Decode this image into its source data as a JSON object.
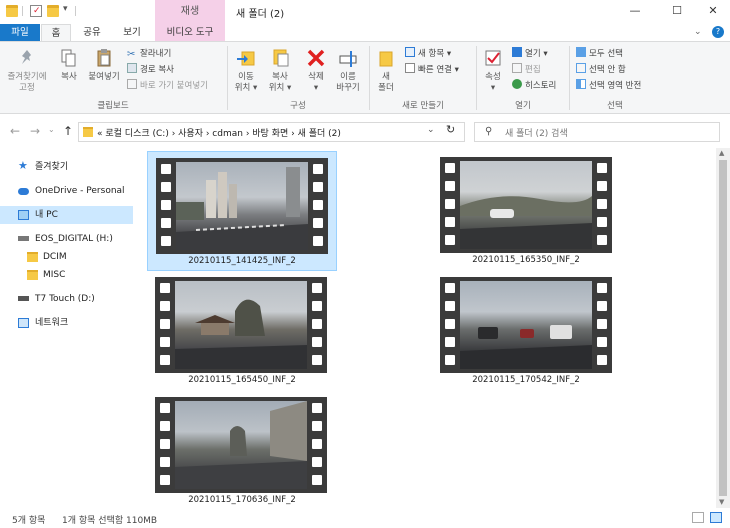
{
  "window": {
    "title": "새 폴더 (2)",
    "context_tab": "재생",
    "controls": [
      "—",
      "☐",
      "✕"
    ]
  },
  "ribbon_tabs": [
    {
      "label": "파일",
      "kind": "file"
    },
    {
      "label": "홈",
      "kind": "active"
    },
    {
      "label": "공유",
      "kind": "normal"
    },
    {
      "label": "보기",
      "kind": "normal"
    },
    {
      "label": "비디오 도구",
      "kind": "video"
    }
  ],
  "ribbon": {
    "clipboard": {
      "pin_label": "즐겨찾기에\n고정",
      "copy_label": "복사",
      "paste_label": "붙여넣기",
      "cut_label": "잘라내기",
      "copy_path_label": "경로 복사",
      "paste_shortcut_label": "바로 가기 붙여넣기",
      "group_label": "클립보드"
    },
    "organize": {
      "move_label": "이동\n위치 ▾",
      "copyto_label": "복사\n위치 ▾",
      "delete_label": "삭제\n▾",
      "rename_label": "이름\n바꾸기",
      "group_label": "구성"
    },
    "new": {
      "newfolder_label": "새\n폴더",
      "newitem_label": "새 항목 ▾",
      "easyaccess_label": "빠른 연결 ▾",
      "group_label": "새로 만들기"
    },
    "open": {
      "properties_label": "속성\n▾",
      "open_label": "열기 ▾",
      "edit_label": "편집",
      "history_label": "히스토리",
      "group_label": "열기"
    },
    "select": {
      "all_label": "모두 선택",
      "none_label": "선택 안 함",
      "invert_label": "선택 영역 반전",
      "group_label": "선택"
    }
  },
  "address": {
    "breadcrumb": "«  로컬 디스크 (C:)  ›  사용자  ›  cdman  ›  바탕 화면  ›  새 폴더 (2)",
    "search_placeholder": "새 폴더 (2) 검색"
  },
  "nav": {
    "items": [
      {
        "label": "즐겨찾기",
        "icon": "star-icon"
      },
      {
        "label": "OneDrive - Personal",
        "icon": "cloud-icon"
      },
      {
        "label": "내 PC",
        "icon": "pc-icon"
      },
      {
        "label": "EOS_DIGITAL (H:)",
        "icon": "drive-icon"
      },
      {
        "label": "DCIM",
        "icon": "folder-icon"
      },
      {
        "label": "MISC",
        "icon": "folder-icon"
      },
      {
        "label": "T7 Touch (D:)",
        "icon": "drive-icon"
      },
      {
        "label": "네트워크",
        "icon": "network-icon"
      }
    ]
  },
  "files": [
    {
      "name": "20210115_141425_INF_2",
      "selected": true
    },
    {
      "name": "20210115_165350_INF_2",
      "selected": false
    },
    {
      "name": "20210115_165450_INF_2",
      "selected": false
    },
    {
      "name": "20210115_170542_INF_2",
      "selected": false
    },
    {
      "name": "20210115_170636_INF_2",
      "selected": false
    }
  ],
  "status": {
    "count": "5개 항목",
    "selection": "1개 항목 선택함 110MB"
  },
  "colors": {
    "accent": "#1979ca",
    "selection": "#cce8ff",
    "video_tab": "#f5d0e8"
  }
}
